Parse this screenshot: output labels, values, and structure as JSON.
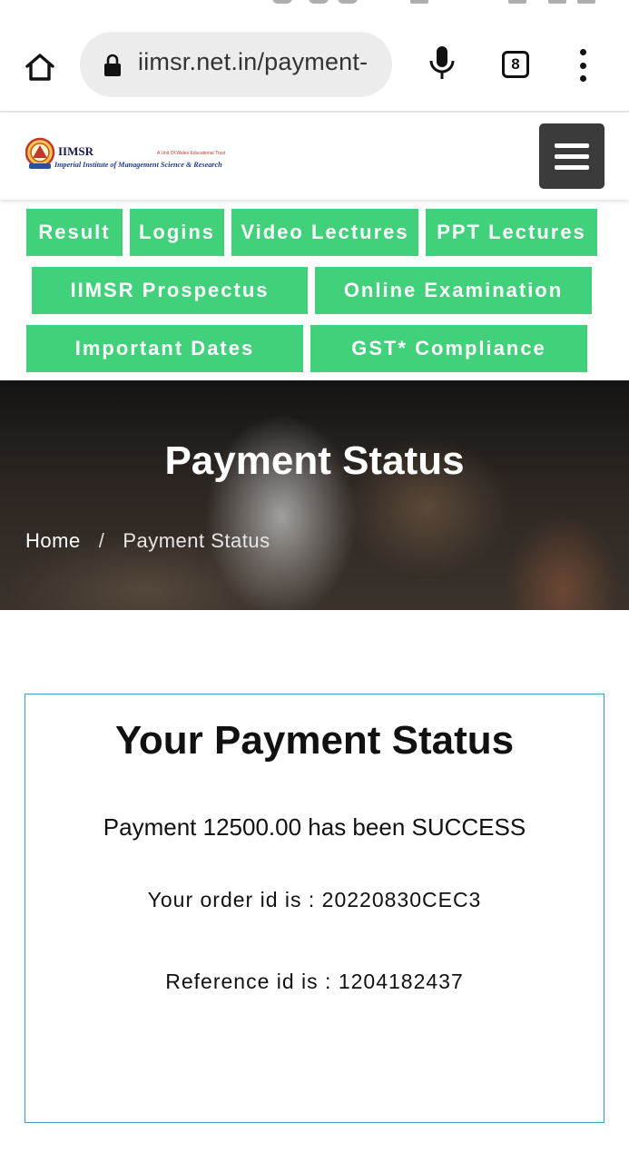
{
  "browser": {
    "url": "iimsr.net.in/payment-",
    "tab_count": "8"
  },
  "site": {
    "logo_name": "IIMSR",
    "logo_subtitle": "Imperial Institute of Management Science & Research",
    "logo_unit": "A Unit Of Wales Educational Trust"
  },
  "nav": {
    "row1": [
      "Result",
      "Logins",
      "Video Lectures",
      "PPT Lectures"
    ],
    "row2": [
      "IIMSR Prospectus",
      "Online Examination"
    ],
    "row3": [
      "Important Dates",
      "GST* Compliance"
    ]
  },
  "hero": {
    "title": "Payment Status",
    "breadcrumb_home": "Home",
    "breadcrumb_sep": "/",
    "breadcrumb_current": "Payment Status"
  },
  "status_card": {
    "title": "Your Payment Status",
    "payment_text": "Payment 12500.00 has been SUCCESS",
    "order_text": "Your order id is : 20220830CEC3",
    "reference_text": "Reference id is : 1204182437"
  },
  "colors": {
    "nav_green": "#40d17a",
    "menu_dark": "#3b3b3b",
    "card_border": "#3b9fc4"
  }
}
